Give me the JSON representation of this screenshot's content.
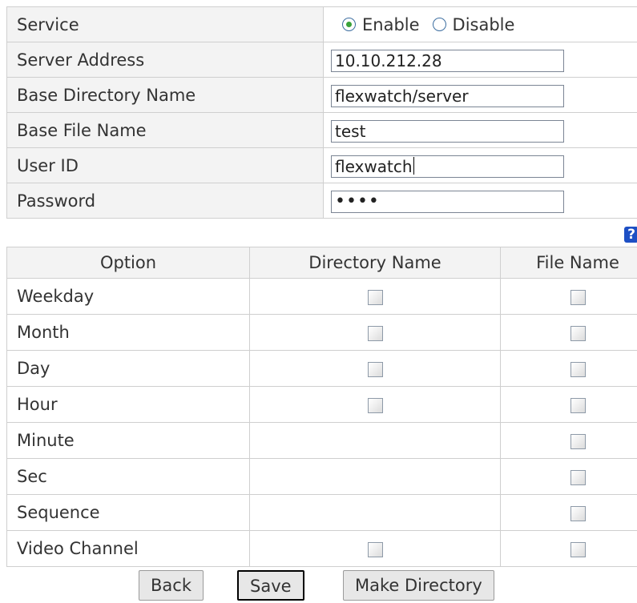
{
  "settings": {
    "service_label": "Service",
    "service_options": [
      "Enable",
      "Disable"
    ],
    "service_selected": "Enable",
    "server_address_label": "Server Address",
    "server_address_value": "10.10.212.28",
    "base_dir_label": "Base Directory Name",
    "base_dir_value": "flexwatch/server",
    "base_file_label": "Base File Name",
    "base_file_value": "test",
    "user_id_label": "User ID",
    "user_id_value": "flexwatch",
    "password_label": "Password",
    "password_masked": "••••"
  },
  "help": {
    "glyph": "?"
  },
  "options": {
    "headers": [
      "Option",
      "Directory Name",
      "File Name"
    ],
    "rows": [
      {
        "label": "Weekday",
        "dir": true,
        "file": true
      },
      {
        "label": "Month",
        "dir": true,
        "file": true
      },
      {
        "label": "Day",
        "dir": true,
        "file": true
      },
      {
        "label": "Hour",
        "dir": true,
        "file": true
      },
      {
        "label": "Minute",
        "dir": false,
        "file": true
      },
      {
        "label": "Sec",
        "dir": false,
        "file": true
      },
      {
        "label": "Sequence",
        "dir": false,
        "file": true
      },
      {
        "label": "Video Channel",
        "dir": true,
        "file": true
      }
    ]
  },
  "buttons": {
    "back": "Back",
    "save": "Save",
    "make_dir": "Make Directory"
  }
}
